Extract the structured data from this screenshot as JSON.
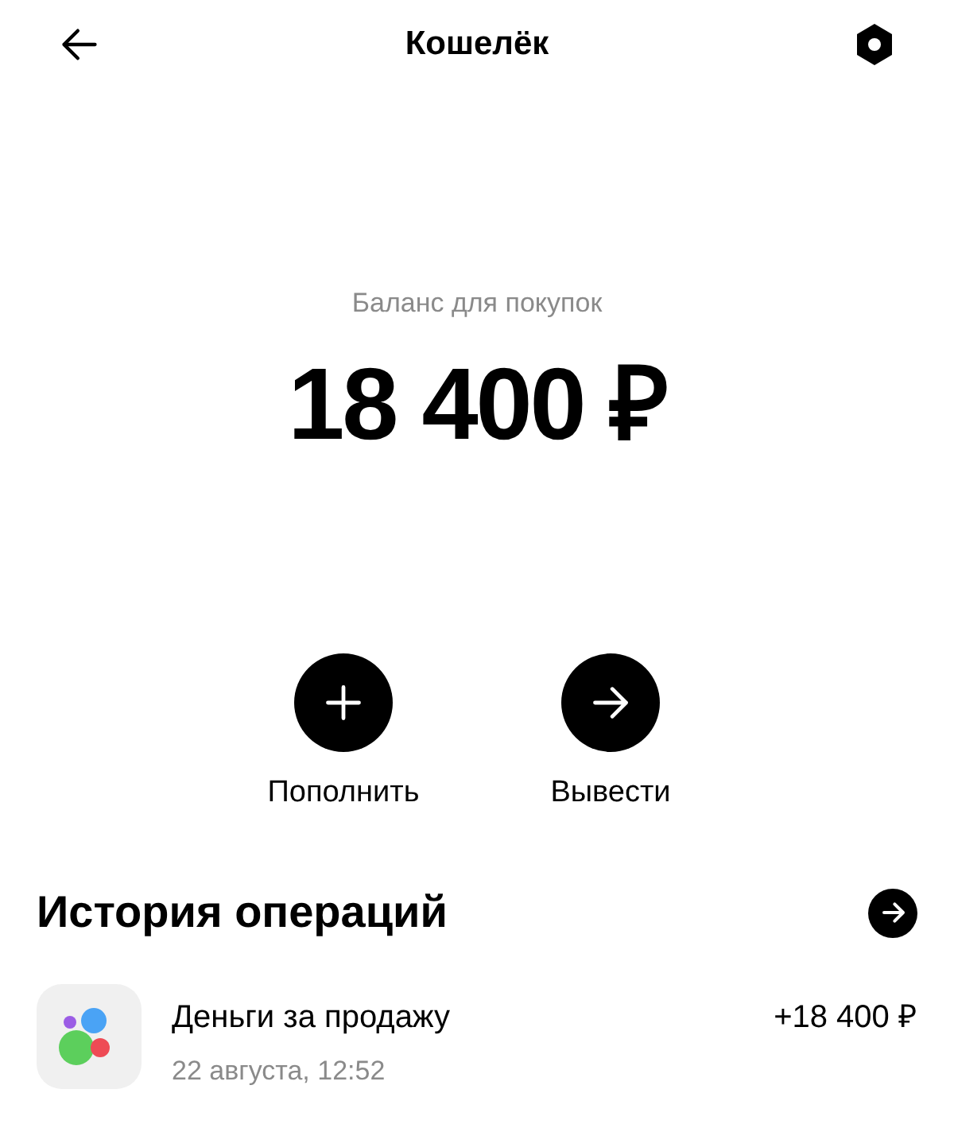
{
  "header": {
    "title": "Кошелёк"
  },
  "balance": {
    "label": "Баланс для покупок",
    "amount": "18 400 ₽"
  },
  "actions": [
    {
      "kind": "add",
      "label": "Пополнить"
    },
    {
      "kind": "withdraw",
      "label": "Вывести"
    }
  ],
  "history": {
    "title": "История операций",
    "operations": [
      {
        "title": "Деньги за продажу",
        "time": "22 августа, 12:52",
        "amount": "+18 400 ₽"
      }
    ]
  }
}
